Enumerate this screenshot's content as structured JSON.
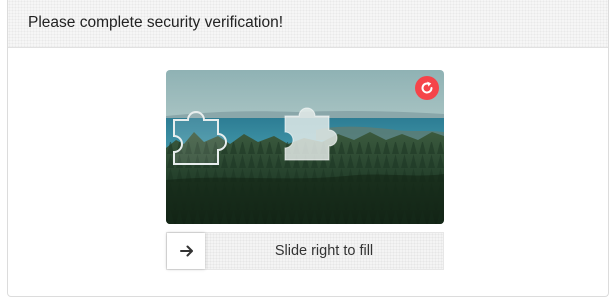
{
  "dialog": {
    "title": "Please complete security verification!"
  },
  "captcha": {
    "refresh_icon": "refresh-icon",
    "puzzle_piece_icon": "puzzle-piece-icon",
    "puzzle_slot_icon": "puzzle-slot-icon",
    "scene": "lake-and-forest-landscape"
  },
  "slider": {
    "handle_icon": "arrow-right-icon",
    "label": "Slide right to fill",
    "progress": 0
  },
  "colors": {
    "refresh_button": "#f5444a",
    "header_background": "#f6f6f6",
    "track_background": "#f4f4f4"
  }
}
